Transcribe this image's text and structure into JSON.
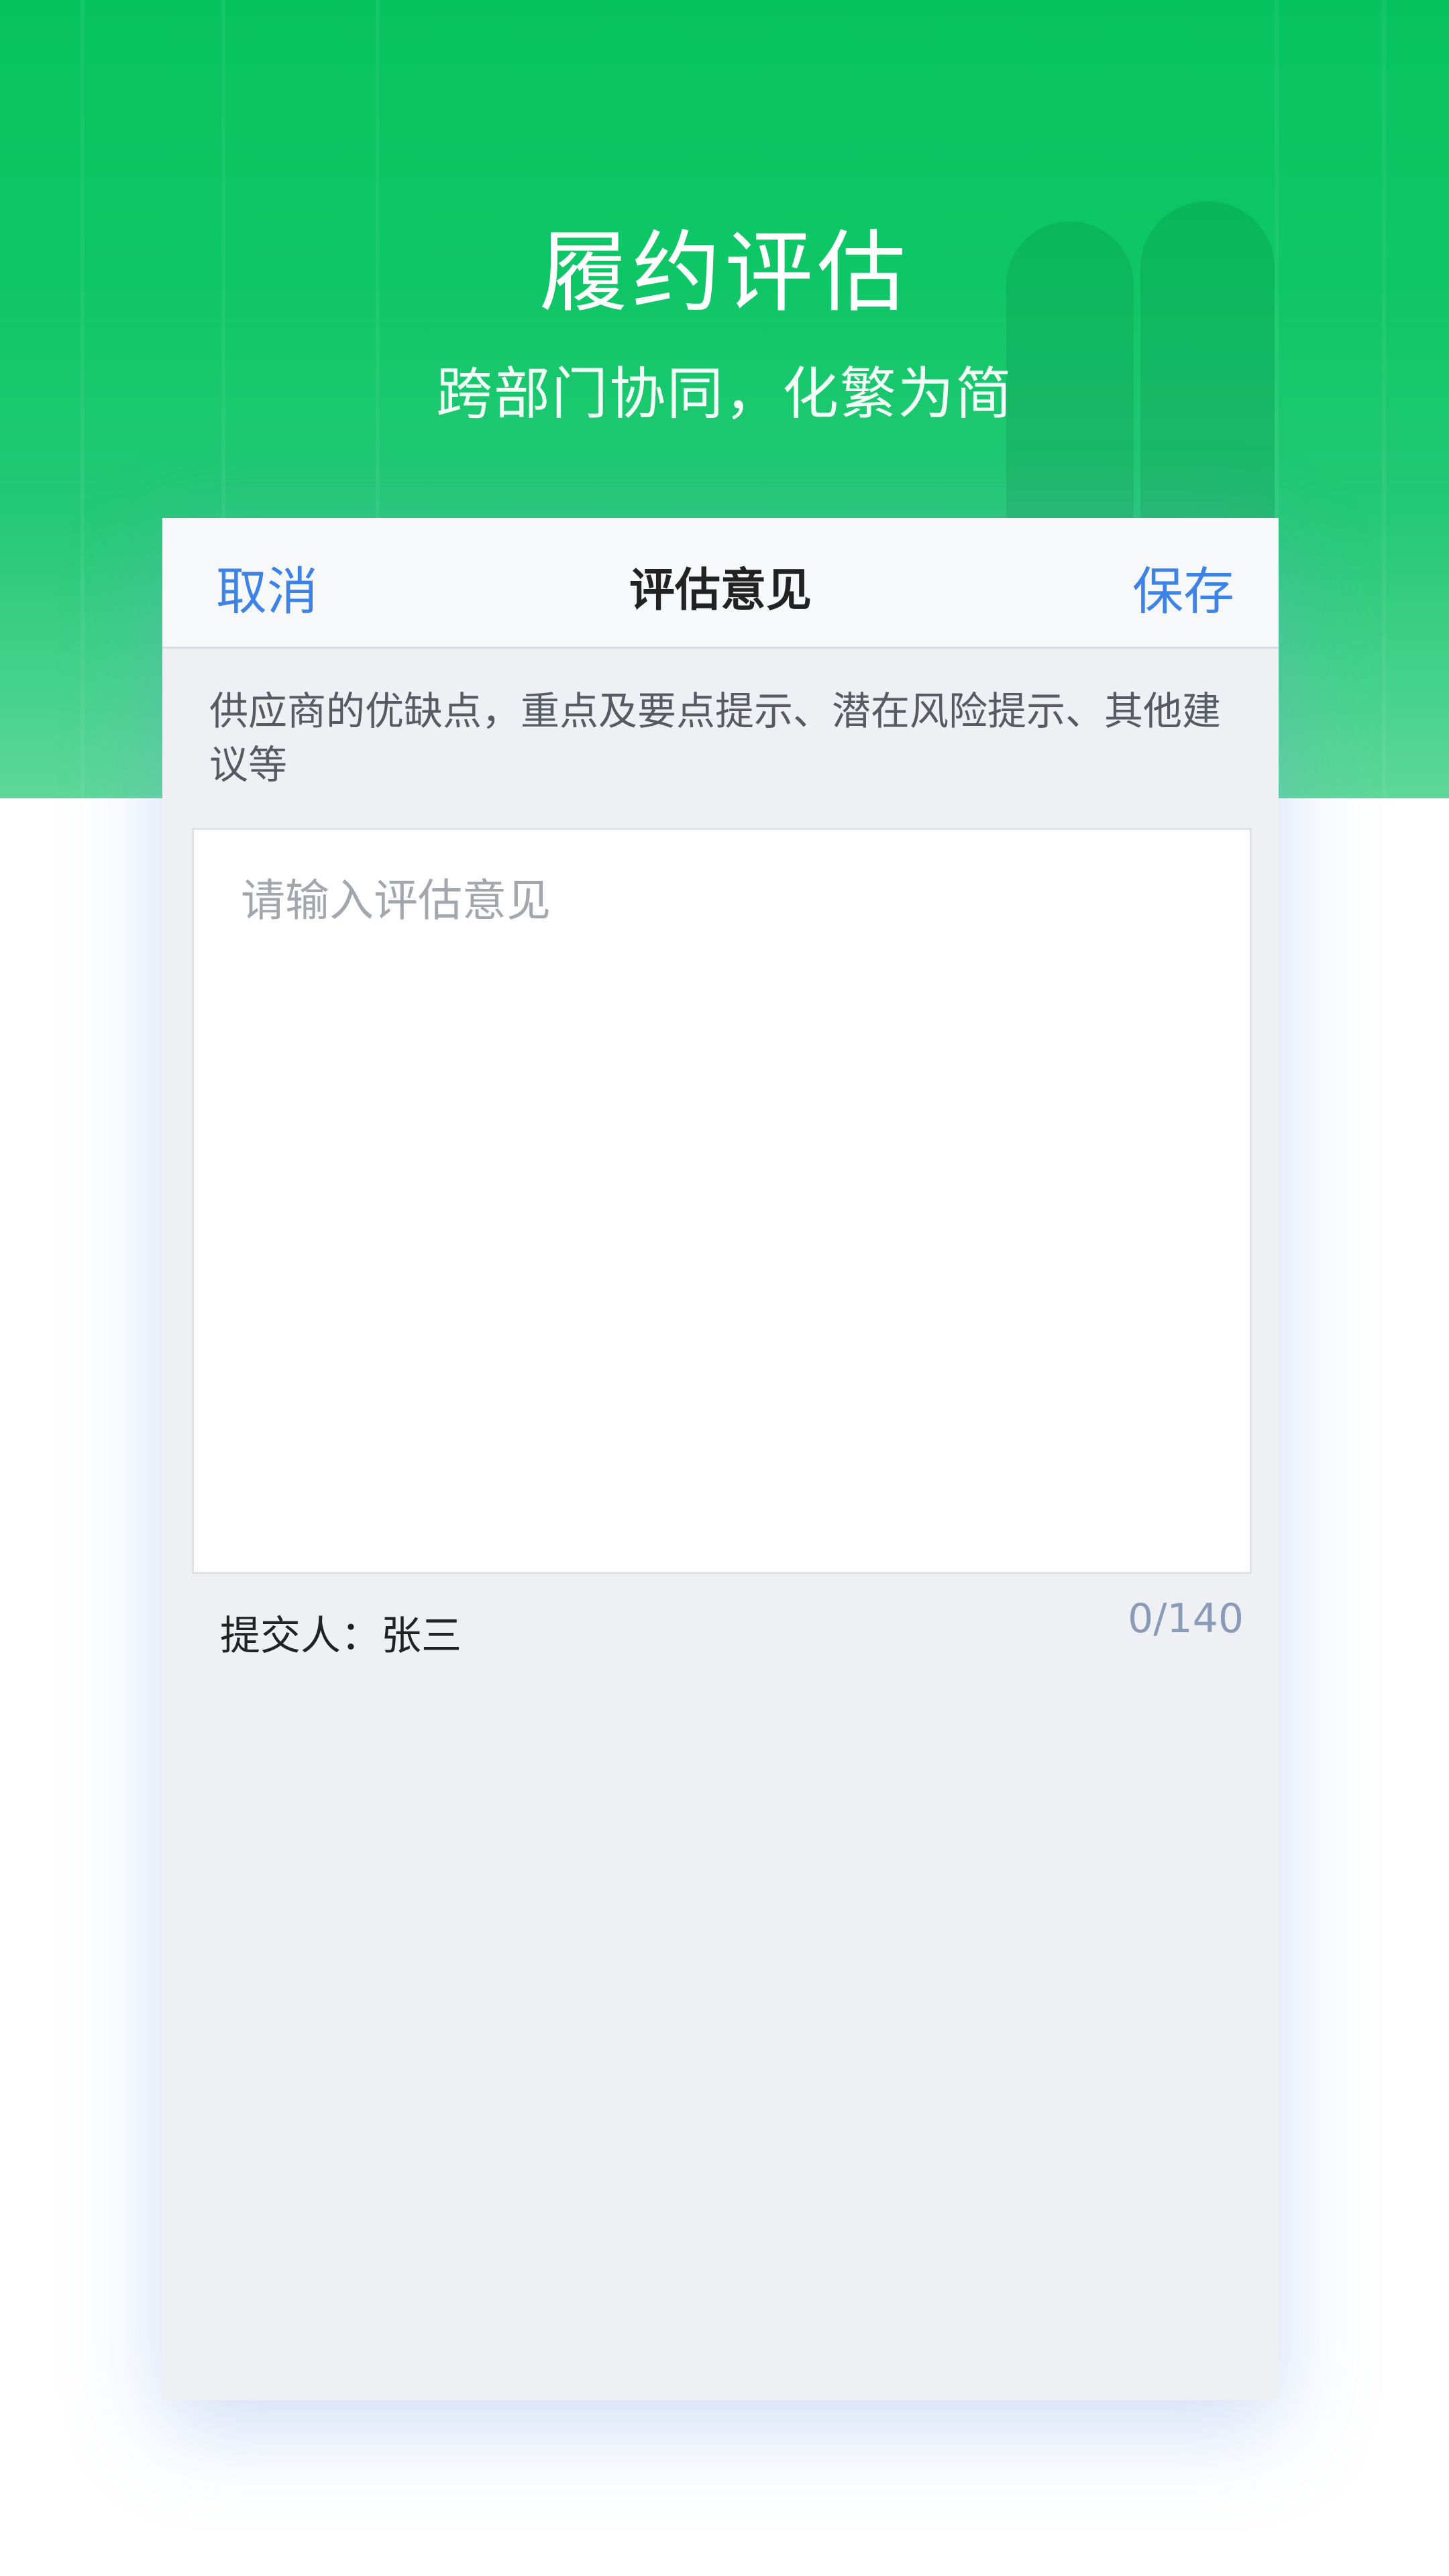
{
  "hero": {
    "title": "履约评估",
    "subtitle": "跨部门协同，化繁为简"
  },
  "nav": {
    "cancel_label": "取消",
    "title": "评估意见",
    "save_label": "保存"
  },
  "form": {
    "hint": "供应商的优缺点，重点及要点提示、潜在风险提示、其他建议等",
    "opinion_value": "",
    "opinion_placeholder": "请输入评估意见",
    "submitter_label": "提交人：张三",
    "counter": "0/140"
  },
  "colors": {
    "brand_green": "#07c35f",
    "link_blue": "#3d82e6",
    "card_bg": "#eef0f4"
  }
}
